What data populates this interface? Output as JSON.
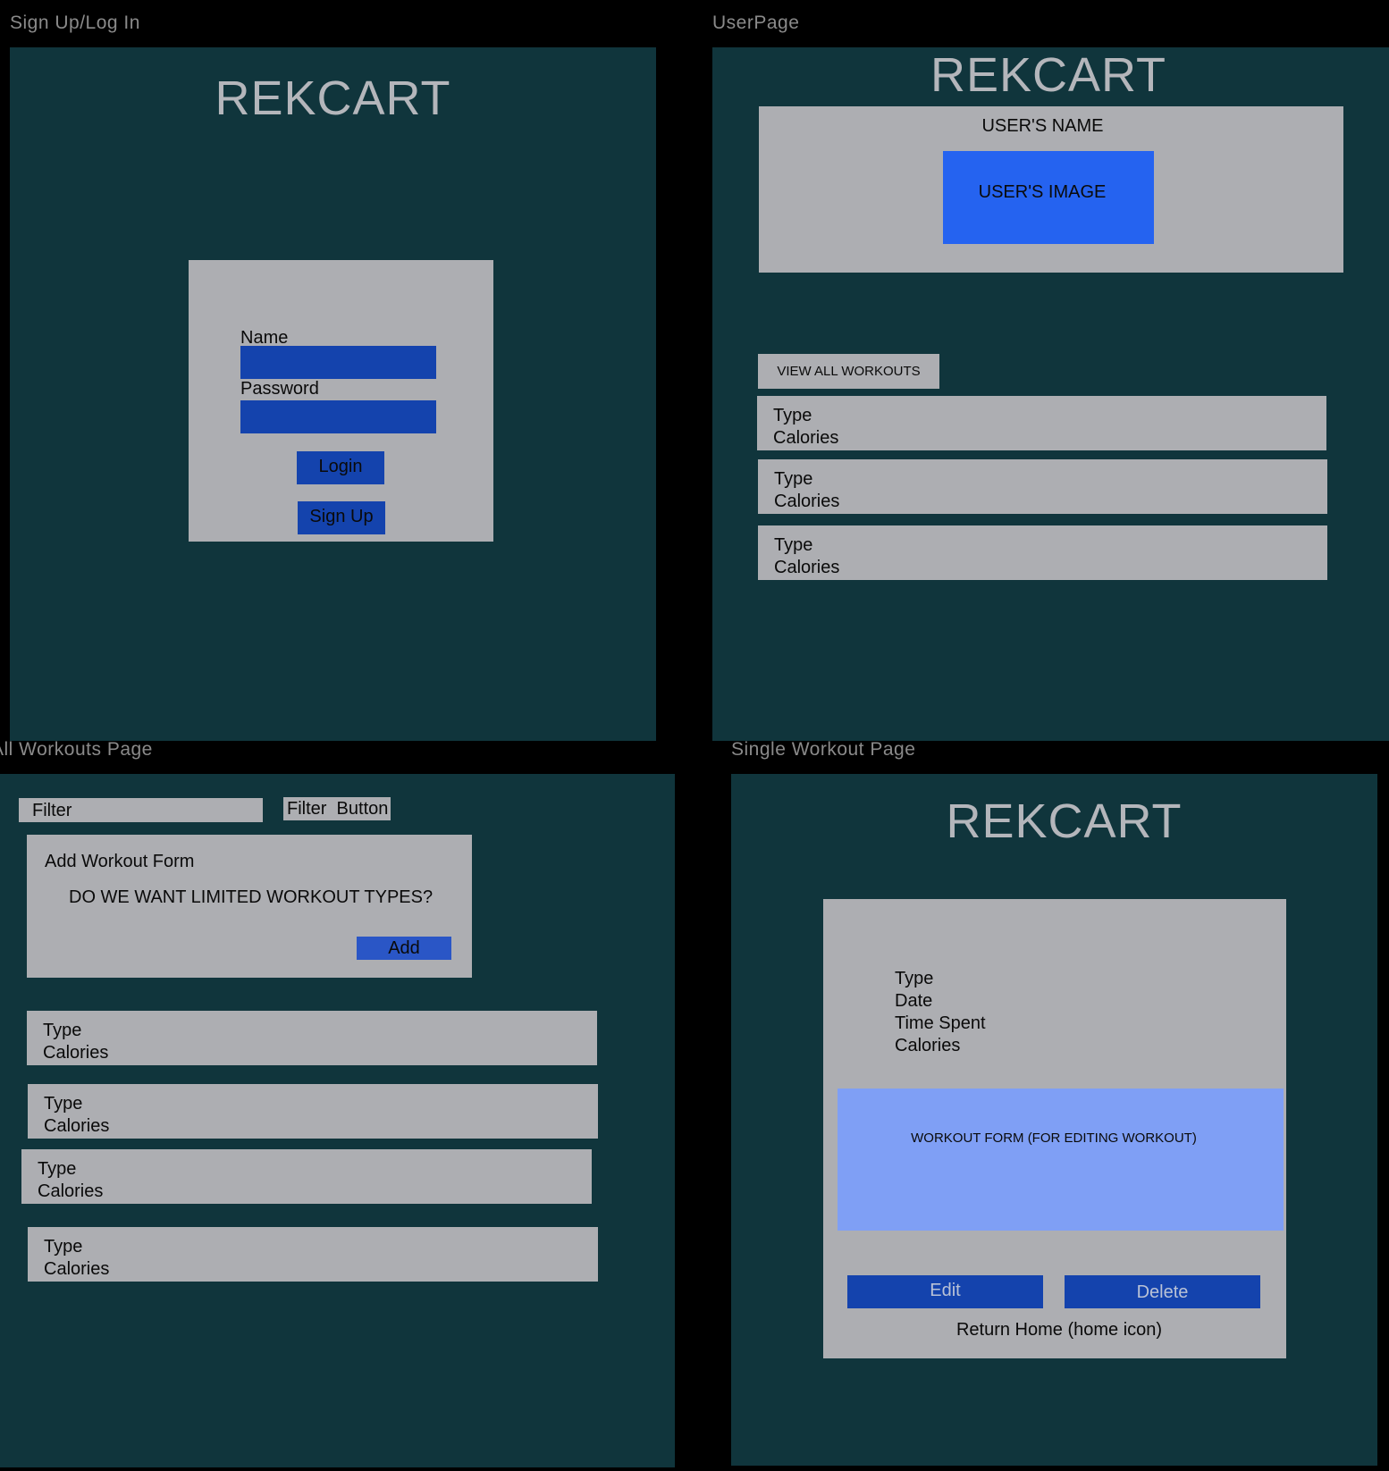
{
  "frames": {
    "signup": {
      "label": "Sign Up/Log In",
      "logo": "REKCART",
      "name_label": "Name",
      "password_label": "Password",
      "login_button": "Login",
      "signup_button": "Sign Up"
    },
    "userpage": {
      "label": "UserPage",
      "logo": "REKCART",
      "user_name": "USER'S NAME",
      "user_image": "USER'S IMAGE",
      "view_all_button": "VIEW ALL WORKOUTS",
      "workouts": [
        {
          "type": "Type",
          "calories": "Calories"
        },
        {
          "type": "Type",
          "calories": "Calories"
        },
        {
          "type": "Type",
          "calories": "Calories"
        }
      ]
    },
    "all_workouts": {
      "label": "All Workouts Page",
      "filter_input": "Filter",
      "filter_button": "Filter  Button",
      "form_title": "Add Workout Form",
      "form_question": "DO WE WANT LIMITED WORKOUT TYPES?",
      "add_button": "Add",
      "workouts": [
        {
          "type": "Type",
          "calories": "Calories"
        },
        {
          "type": "Type",
          "calories": "Calories"
        },
        {
          "type": "Type",
          "calories": "Calories"
        },
        {
          "type": "Type",
          "calories": "Calories"
        }
      ]
    },
    "single_workout": {
      "label": "Single Workout Page",
      "logo": "REKCART",
      "details": [
        "Type",
        "Date",
        "Time Spent",
        "Calories"
      ],
      "edit_form": "WORKOUT FORM (FOR EDITING WORKOUT)",
      "edit_button": "Edit",
      "delete_button": "Delete",
      "return_home": "Return Home (home icon)"
    }
  },
  "colors": {
    "background": "#000000",
    "panel": "#10353c",
    "card": "#adaeb2",
    "button_blue": "#1443ad",
    "image_blue": "#2563f0",
    "form_light_blue": "#7f9ff5"
  }
}
